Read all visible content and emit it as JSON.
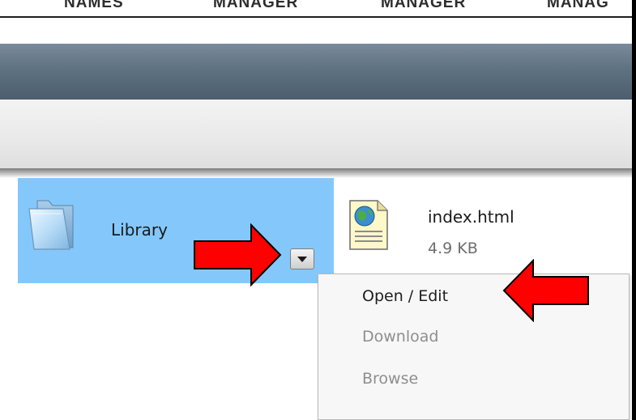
{
  "top_nav": {
    "items": [
      "NAMES",
      "MANAGER",
      "MANAGER",
      "MANAG"
    ]
  },
  "files": {
    "library": {
      "label": "Library",
      "icon": "folder-icon"
    },
    "index": {
      "name": "index.html",
      "size": "4.9 KB",
      "icon": "html-file-icon"
    }
  },
  "context_menu": {
    "items": [
      {
        "label": "Open / Edit",
        "enabled": true
      },
      {
        "label": "Download",
        "enabled": false
      },
      {
        "label": "Browse",
        "enabled": false
      }
    ]
  },
  "colors": {
    "selection": "#84c8fb",
    "header_dark": "#5f7282",
    "arrow_red": "#ff0000",
    "disabled_text": "#8e8e8e"
  }
}
